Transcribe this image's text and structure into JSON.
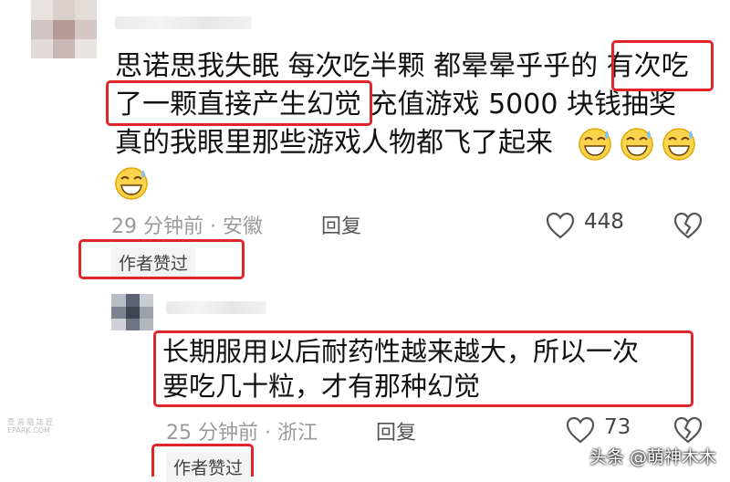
{
  "comment1": {
    "lines": [
      "思诺思我失眠 每次吃半颗 都晕晕乎乎的 有次吃",
      "了一颗直接产生幻觉 充值游戏 5000 块钱抽奖",
      "真的我眼里那些游戏人物都飞了起来"
    ],
    "meta": "29 分钟前 · 安徽",
    "reply_label": "回复",
    "like_count": "448",
    "badge": "作者赞过"
  },
  "comment2": {
    "lines": [
      "长期服用以后耐药性越来越大，所以一次",
      "要吃几十粒，才有那种幻觉"
    ],
    "meta": "25 分钟前 · 浙江",
    "reply_label": "回复",
    "like_count": "73",
    "badge": "作者赞过"
  },
  "watermark": {
    "right": "头条 @萌神木木",
    "left_top": "壹 週 隨 誌 匠",
    "left_bottom": "EPARK.COM"
  },
  "colors": {
    "highlight": "#e0262b",
    "meta": "#9a9a9a",
    "badge_bg": "#f3f3f3"
  }
}
